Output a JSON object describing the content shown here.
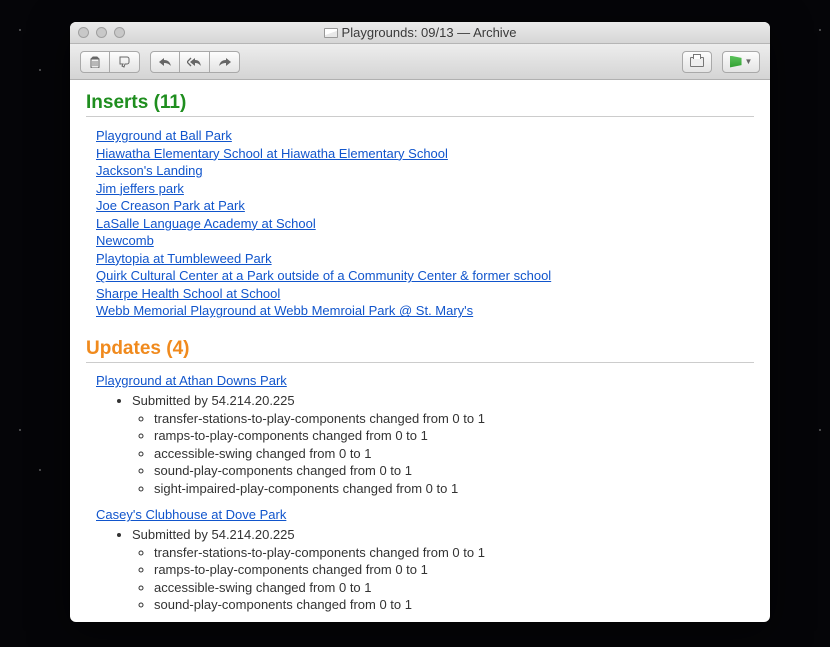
{
  "window": {
    "title": "Playgrounds: 09/13 — Archive"
  },
  "inserts": {
    "heading": "Inserts (11)",
    "items": [
      "Playground at Ball Park",
      "Hiawatha Elementary School at Hiawatha Elementary School",
      "Jackson's Landing",
      "Jim jeffers park",
      "Joe Creason Park at Park",
      "LaSalle Language Academy at School",
      "Newcomb",
      "Playtopia at Tumbleweed Park",
      "Quirk Cultural Center at a Park outside of a Community Center & former school",
      "Sharpe Health School at School",
      "Webb Memorial Playground at Webb Memroial Park @ St. Mary's"
    ]
  },
  "updates": {
    "heading": "Updates (4)",
    "items": [
      {
        "title": "Playground at Athan Downs Park",
        "submitted_by": "Submitted by 54.214.20.225",
        "changes": [
          "transfer-stations-to-play-components changed from 0 to 1",
          "ramps-to-play-components changed from 0 to 1",
          "accessible-swing changed from 0 to 1",
          "sound-play-components changed from 0 to 1",
          "sight-impaired-play-components changed from 0 to 1"
        ]
      },
      {
        "title": "Casey's Clubhouse at Dove Park",
        "submitted_by": "Submitted by 54.214.20.225",
        "changes": [
          "transfer-stations-to-play-components changed from 0 to 1",
          "ramps-to-play-components changed from 0 to 1",
          "accessible-swing changed from 0 to 1",
          "sound-play-components changed from 0 to 1"
        ]
      }
    ]
  }
}
